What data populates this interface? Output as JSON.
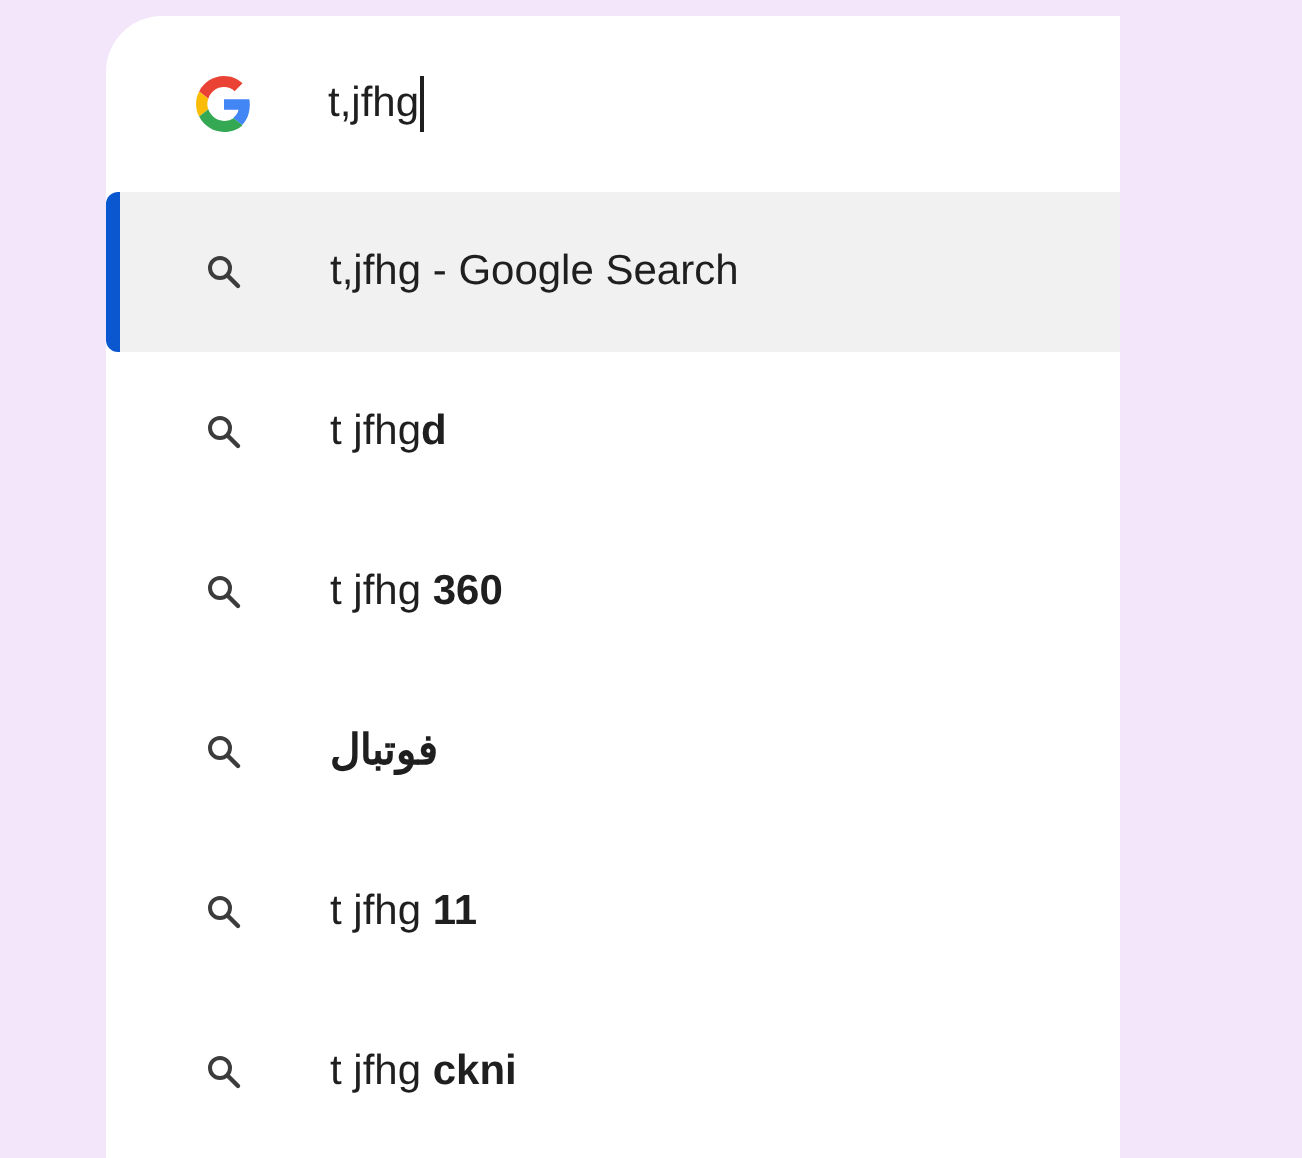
{
  "search_box": {
    "value": "t,jfhg"
  },
  "suggestions": [
    {
      "text": "t,jfhg - Google Search",
      "selected": true,
      "bold": false
    },
    {
      "text": "t jfhg**d**",
      "selected": false,
      "bold": false
    },
    {
      "text": "t jfhg **360**",
      "selected": false,
      "bold": false
    },
    {
      "text": "فوتبال",
      "selected": false,
      "bold": true
    },
    {
      "text": "t jfhg **11**",
      "selected": false,
      "bold": false
    },
    {
      "text": "t jfhg **ckni**",
      "selected": false,
      "bold": false
    }
  ]
}
